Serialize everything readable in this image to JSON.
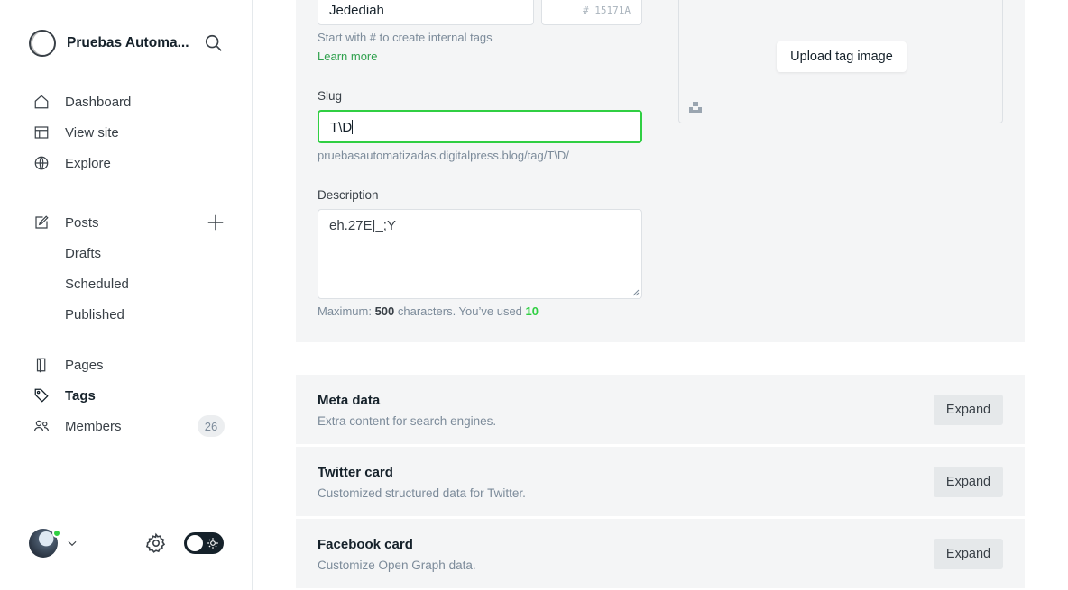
{
  "brand": {
    "name": "Pruebas Automa..."
  },
  "nav": {
    "dashboard": "Dashboard",
    "view_site": "View site",
    "explore": "Explore",
    "posts": "Posts",
    "drafts": "Drafts",
    "scheduled": "Scheduled",
    "published": "Published",
    "pages": "Pages",
    "tags": "Tags",
    "members": "Members",
    "members_count": "26",
    "active": "tags"
  },
  "form": {
    "name_value": "Jedediah",
    "color_placeholder": "# 15171A",
    "name_hint": "Start with # to create internal tags",
    "learn_more": "Learn more",
    "slug_label": "Slug",
    "slug_value": "T\\D",
    "slug_url": "pruebasautomatizadas.digitalpress.blog/tag/T\\D/",
    "description_label": "Description",
    "description_value": "eh.27E|_;Y",
    "max_prefix": "Maximum: ",
    "max_value": "500",
    "max_mid": " characters. You’ve used ",
    "used_value": "10"
  },
  "image": {
    "upload_label": "Upload tag image"
  },
  "sections": [
    {
      "title": "Meta data",
      "subtitle": "Extra content for search engines.",
      "button": "Expand"
    },
    {
      "title": "Twitter card",
      "subtitle": "Customized structured data for Twitter.",
      "button": "Expand"
    },
    {
      "title": "Facebook card",
      "subtitle": "Customize Open Graph data.",
      "button": "Expand"
    }
  ],
  "colors": {
    "accent": "#30cf43",
    "link": "#30a14e",
    "text": "#15212a",
    "muted": "#7c8b9a",
    "panel": "#f4f5f6"
  },
  "icons": [
    "search-icon",
    "home-icon",
    "view-site-icon",
    "explore-icon",
    "posts-icon",
    "plus-icon",
    "pages-icon",
    "tag-icon",
    "members-icon",
    "chevron-down-icon",
    "gear-icon",
    "sun-icon",
    "unsplash-icon"
  ]
}
